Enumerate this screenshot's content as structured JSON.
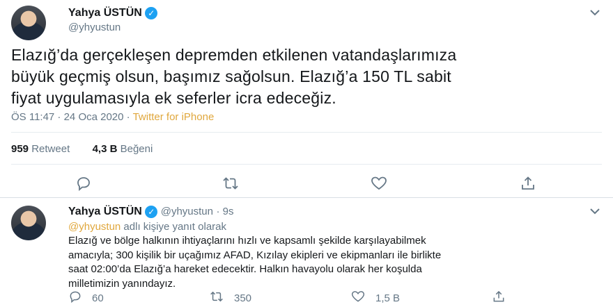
{
  "tweet": {
    "author_name": "Yahya ÜSTÜN",
    "author_handle": "@yhyustun",
    "text_lines": [
      "Elazığ’da gerçekleşen depremden etkilenen vatandaşlarımıza",
      "büyük geçmiş olsun, başımız sağolsun. Elazığ’a  150 TL sabit",
      "fiyat uygulamasıyla ek seferler icra edeceğiz."
    ],
    "time": "ÖS 11:47 · 24 Oca 2020 ·",
    "source": "Twitter for iPhone",
    "retweet_count": "959",
    "retweet_label": "Retweet",
    "like_count": "4,3 B",
    "like_label": "Beğeni"
  },
  "reply": {
    "author_name": "Yahya ÜSTÜN",
    "author_handle": "@yhyustun",
    "age": "· 9s",
    "reply_mention": "@yhyustun",
    "reply_suffix": " adlı kişiye yanıt olarak",
    "text_lines": [
      "Elazığ ve bölge halkının ihtiyaçlarını hızlı ve kapsamlı şekilde karşılayabilmek",
      "amacıyla; 300 kişilik bir uçağımız AFAD, Kızılay ekipleri ve ekipmanları ile birlikte",
      "saat 02:00’da Elazığ’a hareket edecektir. Halkın havayolu olarak her koşulda",
      "milletimizin yanındayız."
    ],
    "reply_count": "60",
    "retweet_count": "350",
    "like_count": "1,5 B"
  },
  "icons": {
    "verified": "verified-icon",
    "chevron": "chevron-down-icon",
    "reply": "reply-icon",
    "retweet": "retweet-icon",
    "like": "heart-icon",
    "share": "share-icon"
  },
  "colors": {
    "accent": "#1da1f2",
    "source_link": "#e0a73c",
    "muted": "#657786"
  }
}
